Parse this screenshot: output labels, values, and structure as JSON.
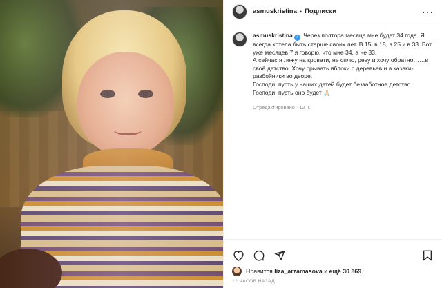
{
  "post": {
    "username": "asmuskristina",
    "follow_label": "Подписки",
    "separator": "•",
    "more_label": "···",
    "caption": {
      "username": "asmuskristina",
      "lines": [
        "Через полтора месяца мне будет 34 года. Я всегда хотела быть старше своих лет. В 15, в 18, в 25 и в 33. Вот уже месяцев 7 я говорю, что мне 34, а не 33.",
        "А сейчас я лежу на кровати, не сплю, реву и хочу обратно……в своё детство. Хочу срывать яблоки с деревьев и в казаки-разбойники во дворе.",
        "Господи, пусть у наших детей будет беззаботное детство.",
        "Господи, пусть оно будет 🙏🏻"
      ],
      "edited": "Отредактировано · 12 ч."
    },
    "likes": {
      "prefix": "Нравится ",
      "user": "liza_arzamasova",
      "middle": " и ",
      "count": "ещё 30 869"
    },
    "timestamp": "12 ЧАСОВ НАЗАД"
  },
  "icons": [
    "heart-icon",
    "comment-icon",
    "share-icon",
    "bookmark-icon",
    "verified-icon",
    "more-icon"
  ],
  "colors": {
    "verified": "#3897f0",
    "muted": "#8e8e8e",
    "text": "#262626",
    "border": "#efefef"
  }
}
